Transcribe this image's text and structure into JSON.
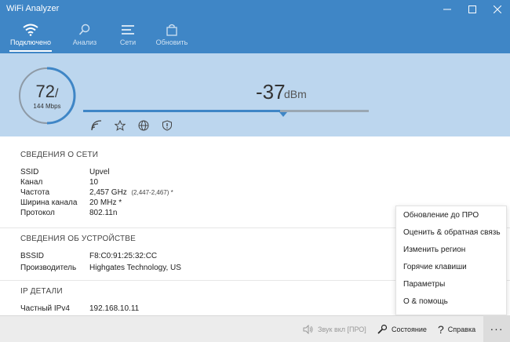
{
  "window": {
    "title": "WiFi Analyzer",
    "minimize": "—",
    "maximize": "☐",
    "close": "✕"
  },
  "nav": {
    "tabs": [
      {
        "label": "Подключено",
        "icon": "wifi-icon",
        "active": true
      },
      {
        "label": "Анализ",
        "icon": "search-icon",
        "active": false
      },
      {
        "label": "Сети",
        "icon": "list-icon",
        "active": false
      },
      {
        "label": "Обновить",
        "icon": "shopping-bag-icon",
        "active": false
      }
    ]
  },
  "signal": {
    "link_speed": "72",
    "slash": "/",
    "max_speed": "144 Mbps",
    "link_fraction": 0.5,
    "dbm_value": "-37",
    "dbm_unit": "dBm",
    "strength_fraction": 0.69,
    "icons": [
      "signal-icon",
      "star-icon",
      "globe-icon",
      "shield-icon"
    ]
  },
  "network": {
    "heading": "СВЕДЕНИЯ О СЕТИ",
    "rows": [
      {
        "key": "SSID",
        "value": "Upvel",
        "extra": ""
      },
      {
        "key": "Канал",
        "value": "10",
        "extra": ""
      },
      {
        "key": "Частота",
        "value": "2,457 GHz",
        "extra": "(2,447-2,467) *"
      },
      {
        "key": "Ширина канала",
        "value": "20 MHz *",
        "extra": ""
      },
      {
        "key": "Протокол",
        "value": "802.11n",
        "extra": ""
      }
    ]
  },
  "device": {
    "heading": "СВЕДЕНИЯ ОБ УСТРОЙСТВЕ",
    "rows": [
      {
        "key": "BSSID",
        "value": "F8:C0:91:25:32:CC"
      },
      {
        "key": "Производитель",
        "value": "Highgates Technology, US"
      }
    ]
  },
  "ip": {
    "heading": "IP ДЕТАЛИ",
    "rows": [
      {
        "key": "Частный IPv4",
        "value": "192.168.10.11"
      }
    ]
  },
  "menu": {
    "items": [
      "Обновление до ПРО",
      "Оценить & обратная связь",
      "Изменить регион",
      "Горячие клавиши",
      "Параметры",
      "О & помощь"
    ]
  },
  "statusbar": {
    "sound": "Звук вкл [ПРО]",
    "status": "Состояние",
    "help": "Справка",
    "more": "···"
  },
  "colors": {
    "accent": "#3f86c6",
    "hero_bg": "#bcd6ee",
    "status_bg": "#ececec"
  }
}
